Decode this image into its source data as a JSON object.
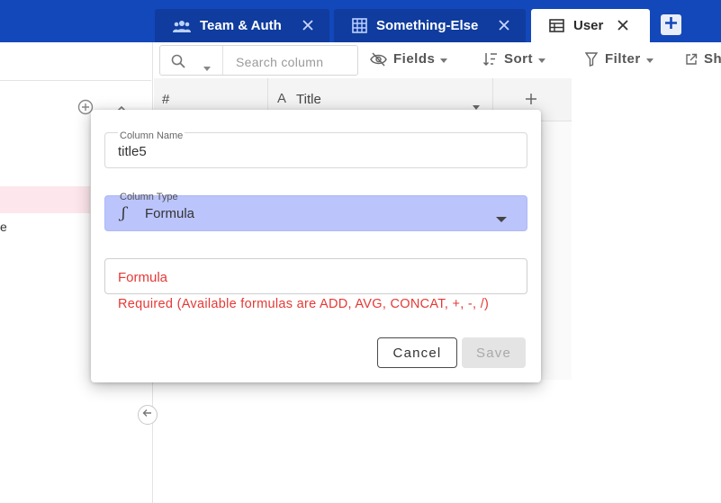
{
  "tabs": [
    {
      "label": "Team & Auth",
      "icon": "users-icon",
      "active": false
    },
    {
      "label": "Something-Else",
      "icon": "grid-icon",
      "active": false
    },
    {
      "label": "User",
      "icon": "table-icon",
      "active": true
    }
  ],
  "colors": {
    "topbar": "#1348ba",
    "tab_inactive": "#0f3c9e",
    "type_select_bg": "#bbc4fb",
    "error": "#e53935",
    "sidebar_highlight": "#fde7ec"
  },
  "sidebar": {
    "partial_text": "e"
  },
  "toolbar": {
    "search_placeholder": "Search column",
    "fields_label": "Fields",
    "sort_label": "Sort",
    "filter_label": "Filter",
    "share_label": "Sh"
  },
  "grid": {
    "columns": [
      {
        "label": "#"
      },
      {
        "label": "Title",
        "type_icon": "A"
      }
    ]
  },
  "modal": {
    "column_name_label": "Column Name",
    "column_name_value": "title5",
    "column_type_label": "Column Type",
    "column_type_icon": "ʃ",
    "column_type_value": "Formula",
    "formula_placeholder": "Formula",
    "formula_error": "Required (Available formulas are ADD, AVG, CONCAT, +, -, /)",
    "cancel_label": "Cancel",
    "save_label": "Save"
  }
}
